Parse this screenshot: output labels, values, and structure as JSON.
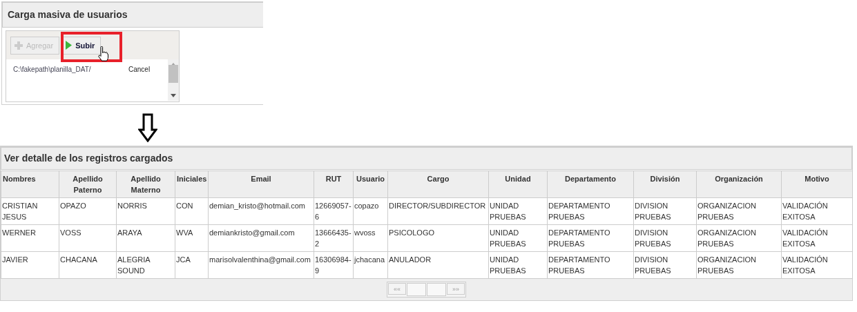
{
  "upload_panel": {
    "title": "Carga masiva de usuarios",
    "toolbar": [
      {
        "label": "Agregar",
        "kind": "add",
        "disabled": true
      },
      {
        "label": "Subir",
        "kind": "upload",
        "disabled": false
      }
    ],
    "files": [
      {
        "name": "C:\\fakepath\\planilla_DAT/",
        "action": "Cancel"
      }
    ]
  },
  "results_panel": {
    "title": "Ver detalle de los registros cargados",
    "table": {
      "columns": [
        "Nombres",
        "Apellido Paterno",
        "Apellido Materno",
        "Iniciales",
        "Email",
        "RUT",
        "Usuario",
        "Cargo",
        "Unidad",
        "Departamento",
        "División",
        "Organización",
        "Motivo"
      ],
      "rows": [
        [
          "CRISTIAN JESUS",
          "OPAZO",
          "NORRIS",
          "CON",
          "demian_kristo@hotmail.com",
          "12669057-6",
          "copazo",
          "DIRECTOR/SUBDIRECTOR",
          "UNIDAD PRUEBAS",
          "DEPARTAMENTO PRUEBAS",
          "DIVISION PRUEBAS",
          "ORGANIZACION PRUEBAS",
          "VALIDACIÓN EXITOSA"
        ],
        [
          "WERNER",
          "VOSS",
          "ARAYA",
          "WVA",
          "demiankristo@gmail.com",
          "13666435-2",
          "wvoss",
          "PSICOLOGO",
          "UNIDAD PRUEBAS",
          "DEPARTAMENTO PRUEBAS",
          "DIVISION PRUEBAS",
          "ORGANIZACION PRUEBAS",
          "VALIDACIÓN EXITOSA"
        ],
        [
          "JAVIER",
          "CHACANA",
          "ALEGRIA SOUND",
          "JCA",
          "marisolvalenthina@gmail.com",
          "16306984-9",
          "jchacana",
          "ANULADOR",
          "UNIDAD PRUEBAS",
          "DEPARTAMENTO PRUEBAS",
          "DIVISION PRUEBAS",
          "ORGANIZACION PRUEBAS",
          "VALIDACIÓN EXITOSA"
        ]
      ]
    },
    "pager": {
      "first": "««",
      "last": "»»"
    }
  }
}
